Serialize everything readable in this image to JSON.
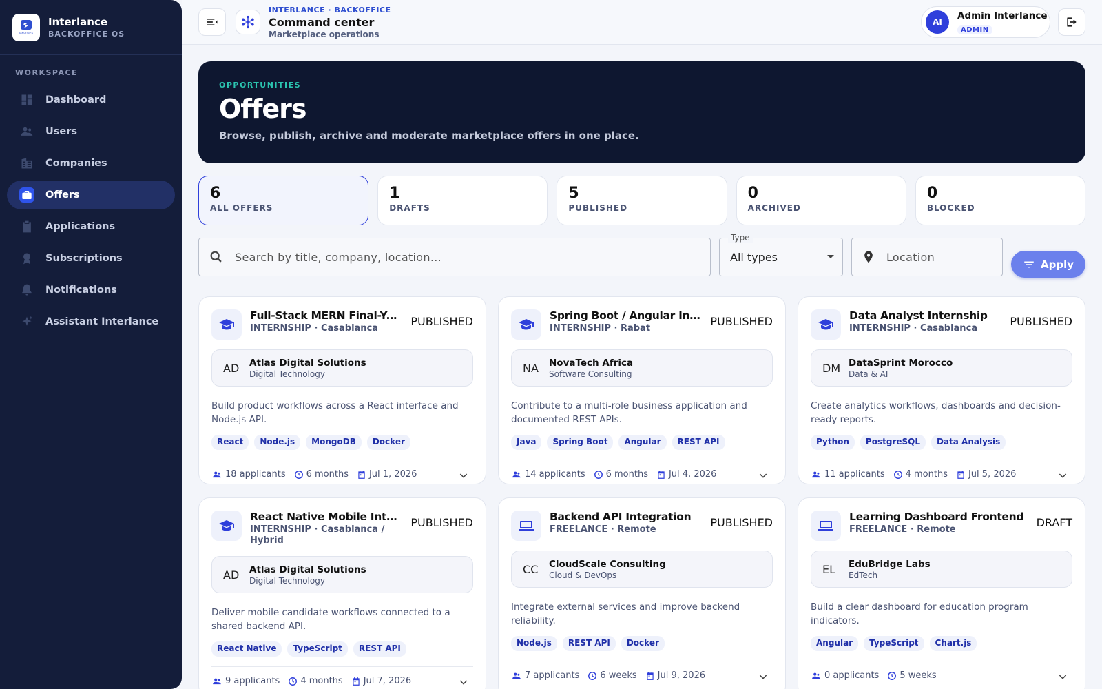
{
  "brand": {
    "name": "Interlance",
    "sub": "BACKOFFICE OS",
    "logo_text": "Interlance"
  },
  "sidebar": {
    "section": "WORKSPACE",
    "items": [
      {
        "label": "Dashboard",
        "icon": "dashboard-icon"
      },
      {
        "label": "Users",
        "icon": "users-icon"
      },
      {
        "label": "Companies",
        "icon": "companies-icon"
      },
      {
        "label": "Offers",
        "icon": "briefcase-icon",
        "active": true
      },
      {
        "label": "Applications",
        "icon": "clipboard-icon"
      },
      {
        "label": "Subscriptions",
        "icon": "badge-icon"
      },
      {
        "label": "Notifications",
        "icon": "bell-icon"
      },
      {
        "label": "Assistant Interlance",
        "icon": "sparkle-icon"
      }
    ]
  },
  "header": {
    "kicker": "INTERLANCE · BACKOFFICE",
    "title": "Command center",
    "subtitle": "Marketplace operations",
    "user": {
      "initials": "AI",
      "name": "Admin Interlance",
      "role": "ADMIN"
    }
  },
  "hero": {
    "kicker": "OPPORTUNITIES",
    "title": "Offers",
    "description": "Browse, publish, archive and moderate marketplace offers in one place."
  },
  "stats": [
    {
      "value": "6",
      "label": "ALL OFFERS",
      "active": true
    },
    {
      "value": "1",
      "label": "DRAFTS"
    },
    {
      "value": "5",
      "label": "PUBLISHED"
    },
    {
      "value": "0",
      "label": "ARCHIVED"
    },
    {
      "value": "0",
      "label": "BLOCKED"
    }
  ],
  "filters": {
    "search_placeholder": "Search by title, company, location...",
    "type_label": "Type",
    "type_value": "All types",
    "location_placeholder": "Location",
    "apply_label": "Apply"
  },
  "offers": [
    {
      "title": "Full-Stack MERN Final-Yea...",
      "meta": "INTERNSHIP · Casablanca",
      "status": "PUBLISHED",
      "icon": "graduation-cap-icon",
      "company_initials": "AD",
      "company": "Atlas Digital Solutions",
      "sector": "Digital Technology",
      "description": "Build product workflows across a React interface and Node.js API.",
      "tags": [
        "React",
        "Node.js",
        "MongoDB",
        "Docker"
      ],
      "applicants": "18 applicants",
      "duration": "6 months",
      "date": "Jul 1, 2026"
    },
    {
      "title": "Spring Boot / Angular Inter...",
      "meta": "INTERNSHIP · Rabat",
      "status": "PUBLISHED",
      "icon": "graduation-cap-icon",
      "company_initials": "NA",
      "company": "NovaTech Africa",
      "sector": "Software Consulting",
      "description": "Contribute to a multi-role business application and documented REST APIs.",
      "tags": [
        "Java",
        "Spring Boot",
        "Angular",
        "REST API"
      ],
      "applicants": "14 applicants",
      "duration": "6 months",
      "date": "Jul 4, 2026"
    },
    {
      "title": "Data Analyst Internship",
      "meta": "INTERNSHIP · Casablanca",
      "status": "PUBLISHED",
      "icon": "graduation-cap-icon",
      "company_initials": "DM",
      "company": "DataSprint Morocco",
      "sector": "Data & AI",
      "description": "Create analytics workflows, dashboards and decision-ready reports.",
      "tags": [
        "Python",
        "PostgreSQL",
        "Data Analysis"
      ],
      "applicants": "11 applicants",
      "duration": "4 months",
      "date": "Jul 5, 2026"
    },
    {
      "title": "React Native Mobile Interns...",
      "meta": "INTERNSHIP · Casablanca / Hybrid",
      "status": "PUBLISHED",
      "icon": "graduation-cap-icon",
      "company_initials": "AD",
      "company": "Atlas Digital Solutions",
      "sector": "Digital Technology",
      "description": "Deliver mobile candidate workflows connected to a shared backend API.",
      "tags": [
        "React Native",
        "TypeScript",
        "REST API"
      ],
      "applicants": "9 applicants",
      "duration": "4 months",
      "date": "Jul 7, 2026"
    },
    {
      "title": "Backend API Integration",
      "meta": "FREELANCE · Remote",
      "status": "PUBLISHED",
      "icon": "laptop-icon",
      "company_initials": "CC",
      "company": "CloudScale Consulting",
      "sector": "Cloud & DevOps",
      "description": "Integrate external services and improve backend reliability.",
      "tags": [
        "Node.js",
        "REST API",
        "Docker"
      ],
      "applicants": "7 applicants",
      "duration": "6 weeks",
      "date": "Jul 9, 2026"
    },
    {
      "title": "Learning Dashboard Frontend",
      "meta": "FREELANCE · Remote",
      "status": "DRAFT",
      "icon": "laptop-icon",
      "company_initials": "EL",
      "company": "EduBridge Labs",
      "sector": "EdTech",
      "description": "Build a clear dashboard for education program indicators.",
      "tags": [
        "Angular",
        "TypeScript",
        "Chart.js"
      ],
      "applicants": "0 applicants",
      "duration": "5 weeks",
      "date": ""
    }
  ]
}
